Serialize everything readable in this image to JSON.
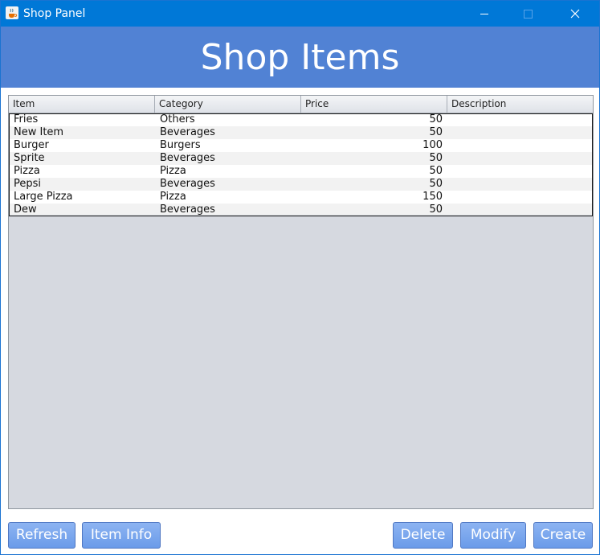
{
  "window": {
    "title": "Shop Panel"
  },
  "header": {
    "title": "Shop Items"
  },
  "table": {
    "columns": [
      "Item",
      "Category",
      "Price",
      "Description"
    ],
    "rows": [
      {
        "item": "Fries",
        "category": "Others",
        "price": "50",
        "description": ""
      },
      {
        "item": "New Item",
        "category": "Beverages",
        "price": "50",
        "description": ""
      },
      {
        "item": "Burger",
        "category": "Burgers",
        "price": "100",
        "description": ""
      },
      {
        "item": "Sprite",
        "category": "Beverages",
        "price": "50",
        "description": ""
      },
      {
        "item": "Pizza",
        "category": "Pizza",
        "price": "50",
        "description": ""
      },
      {
        "item": "Pepsi",
        "category": "Beverages",
        "price": "50",
        "description": ""
      },
      {
        "item": "Large Pizza",
        "category": "Pizza",
        "price": "150",
        "description": ""
      },
      {
        "item": "Dew",
        "category": "Beverages",
        "price": "50",
        "description": ""
      }
    ]
  },
  "buttons": {
    "refresh": "Refresh",
    "item_info": "Item Info",
    "delete": "Delete",
    "modify": "Modify",
    "create": "Create"
  },
  "colors": {
    "titlebar": "#0078d7",
    "header": "#5182d4",
    "button": "#6a9be9",
    "table_background": "#d6d9e0"
  },
  "icons": {
    "app": "java-cup-icon",
    "minimize": "minimize-icon",
    "maximize": "maximize-icon",
    "close": "close-icon"
  }
}
